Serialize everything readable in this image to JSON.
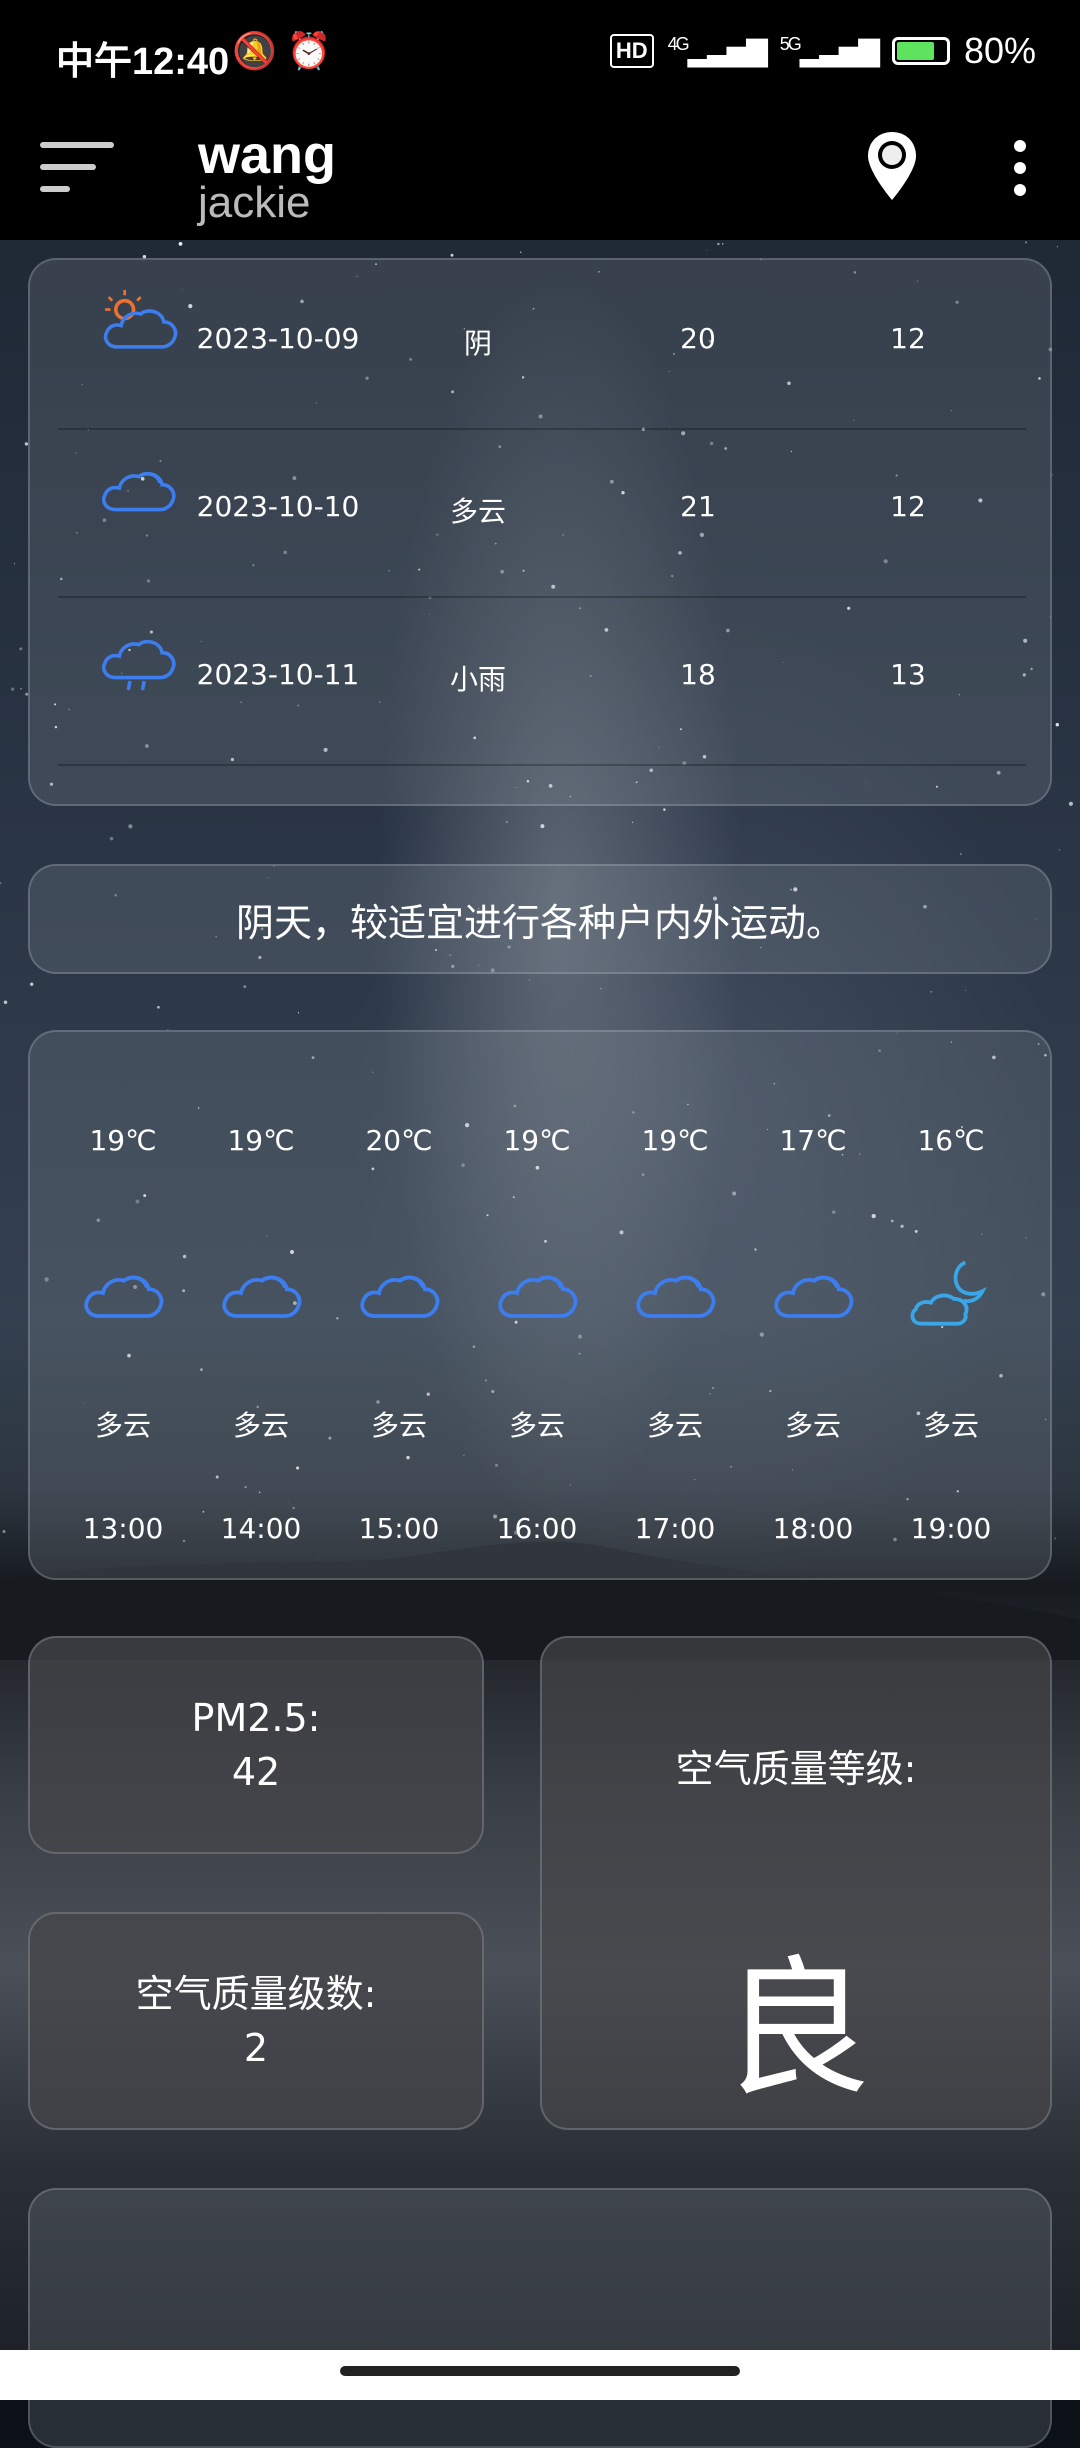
{
  "status_bar": {
    "time": "中午12:40",
    "network_badge": "HD",
    "network_4g": "4G",
    "network_5g": "5G",
    "battery_percent": "80%",
    "battery_level": 0.8
  },
  "app_bar": {
    "title": "wang",
    "subtitle": "jackie",
    "icons": [
      "menu-icon",
      "location-pin-icon",
      "more-vert-icon"
    ]
  },
  "forecast": [
    {
      "date": "2023-10-09",
      "weather": "阴",
      "high": "20",
      "low": "12",
      "icon": "cloud-sun-icon"
    },
    {
      "date": "2023-10-10",
      "weather": "多云",
      "high": "21",
      "low": "12",
      "icon": "cloud-icon"
    },
    {
      "date": "2023-10-11",
      "weather": "小雨",
      "high": "18",
      "low": "13",
      "icon": "cloud-rain-icon"
    }
  ],
  "tip": "阴天，较适宜进行各种户内外运动。",
  "hourly": [
    {
      "temp": "19℃",
      "desc": "多云",
      "time": "13:00",
      "icon": "cloud-icon"
    },
    {
      "temp": "19℃",
      "desc": "多云",
      "time": "14:00",
      "icon": "cloud-icon"
    },
    {
      "temp": "20℃",
      "desc": "多云",
      "time": "15:00",
      "icon": "cloud-icon"
    },
    {
      "temp": "19℃",
      "desc": "多云",
      "time": "16:00",
      "icon": "cloud-icon"
    },
    {
      "temp": "19℃",
      "desc": "多云",
      "time": "17:00",
      "icon": "cloud-icon"
    },
    {
      "temp": "17℃",
      "desc": "多云",
      "time": "18:00",
      "icon": "cloud-icon"
    },
    {
      "temp": "16℃",
      "desc": "多云",
      "time": "19:00",
      "icon": "cloud-moon-icon"
    }
  ],
  "air": {
    "pm25_label": "PM2.5:",
    "pm25_value": "42",
    "level_label": "空气质量级数:",
    "level_value": "2",
    "grade_label": "空气质量等级:",
    "grade_value": "良"
  },
  "colors": {
    "icon_blue": "#3c7df0",
    "sun_orange": "#f07030",
    "moon_blue": "#3aa6e8"
  }
}
